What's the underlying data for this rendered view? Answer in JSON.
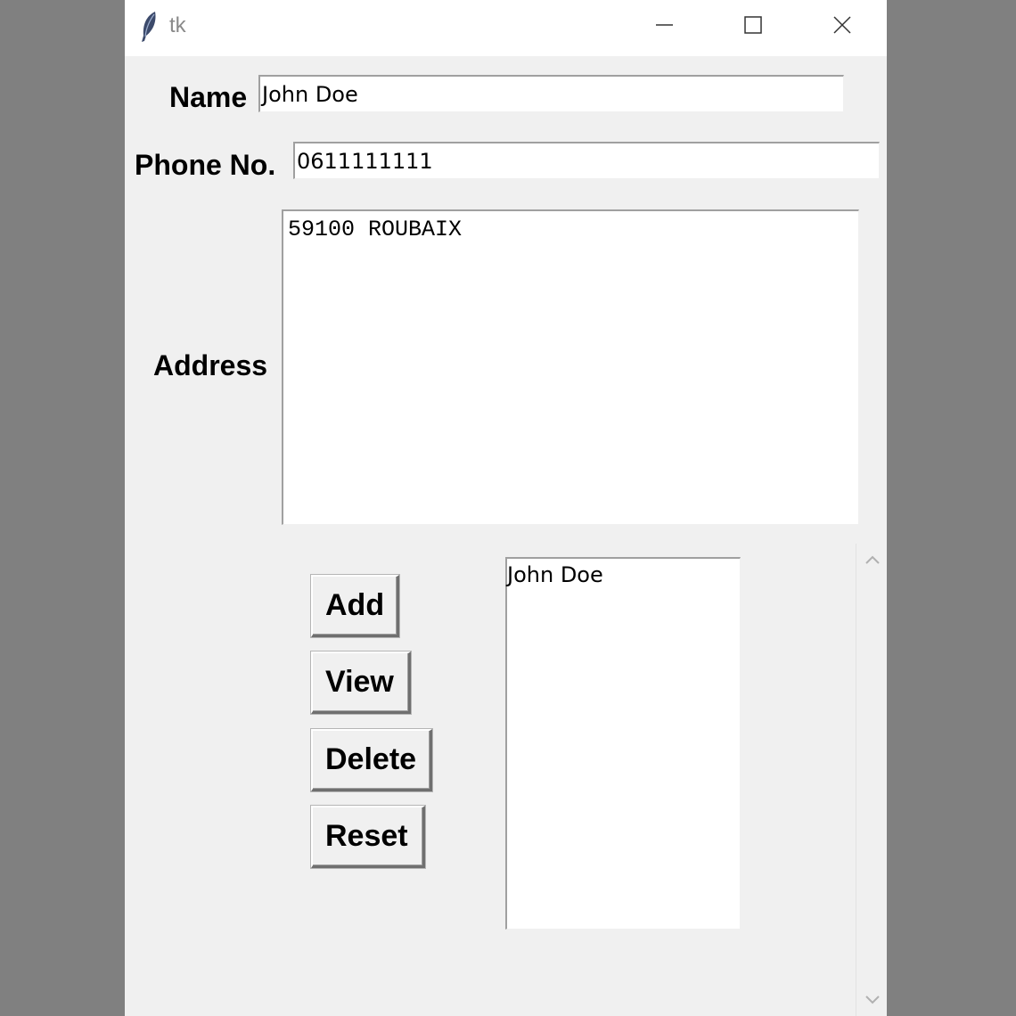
{
  "window": {
    "title": "tk",
    "app_icon": "feather-icon",
    "controls": {
      "minimize_icon": "minimize-icon",
      "maximize_icon": "maximize-icon",
      "close_icon": "close-icon"
    }
  },
  "form": {
    "name_label": "Name",
    "name_value": "John Doe",
    "phone_label": "Phone No.",
    "phone_value": "0611111111",
    "address_label": "Address",
    "address_value": "59100 ROUBAIX"
  },
  "buttons": {
    "add": "Add",
    "view": "View",
    "delete": "Delete",
    "reset": "Reset"
  },
  "contacts_list": {
    "items": [
      "John Doe"
    ]
  },
  "scrollbar": {
    "up_icon": "chevron-up-icon",
    "down_icon": "chevron-down-icon"
  }
}
